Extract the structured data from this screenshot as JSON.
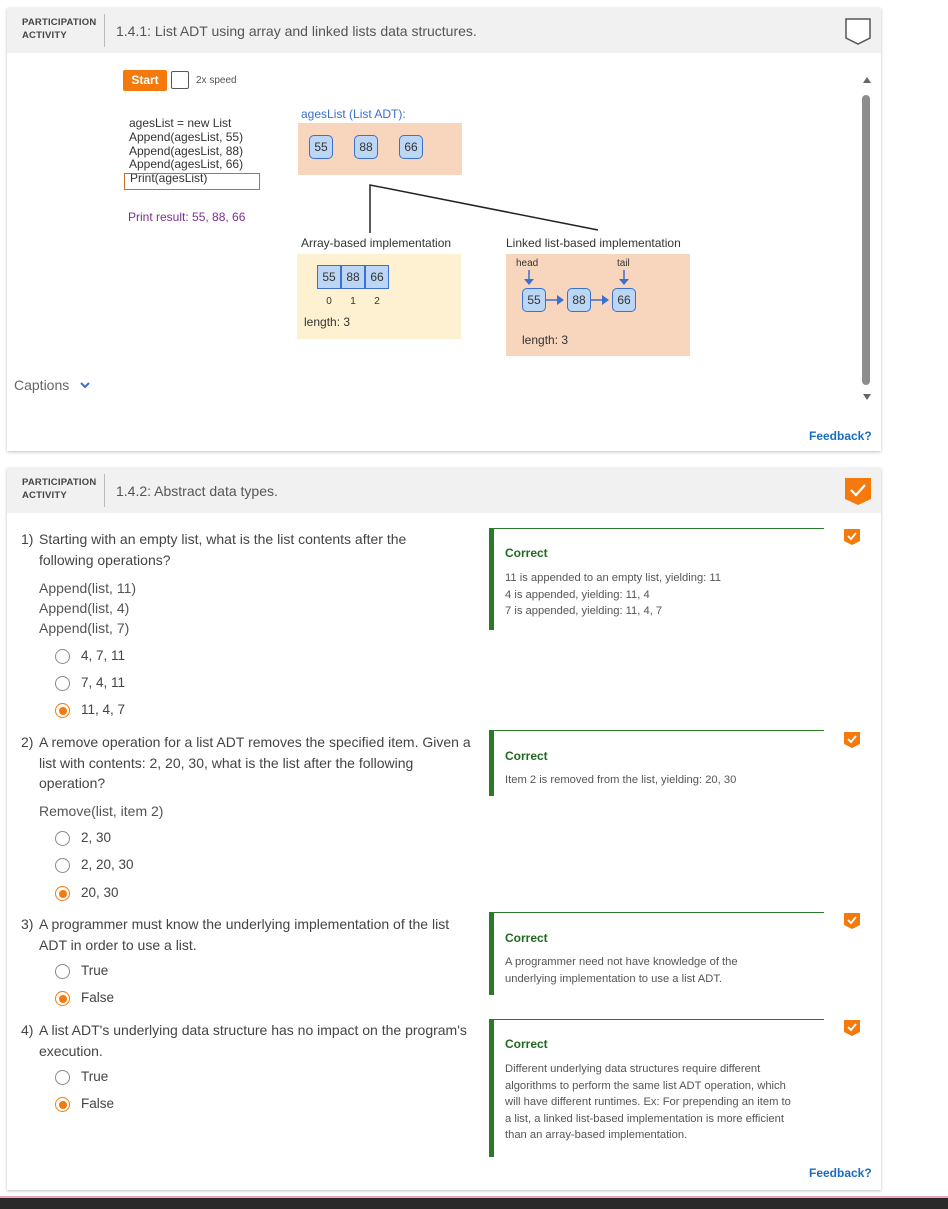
{
  "colors": {
    "accent": "#f47a0e",
    "correct": "#2a7a2a",
    "node_fill": "#bcd7f5",
    "node_border": "#3b6fd0"
  },
  "activity1": {
    "label_line1": "PARTICIPATION",
    "label_line2": "ACTIVITY",
    "title": "1.4.1: List ADT using array and linked lists data structures.",
    "start_label": "Start",
    "speed_label": "2x speed",
    "code_lines": [
      "agesList = new List",
      "Append(agesList, 55)",
      "Append(agesList, 88)",
      "Append(agesList, 66)",
      "Print(agesList)"
    ],
    "print_result": "Print result: 55, 88, 66",
    "adt_label": "agesList (List ADT):",
    "adt_values": [
      "55",
      "88",
      "66"
    ],
    "array_title": "Array-based implementation",
    "array_values": [
      "55",
      "88",
      "66"
    ],
    "array_indices": [
      "0",
      "1",
      "2"
    ],
    "array_length": "length: 3",
    "linked_title": "Linked list-based implementation",
    "head_label": "head",
    "tail_label": "tail",
    "linked_values": [
      "55",
      "88",
      "66"
    ],
    "linked_length": "length: 3",
    "captions_label": "Captions",
    "feedback_label": "Feedback?"
  },
  "activity2": {
    "label_line1": "PARTICIPATION",
    "label_line2": "ACTIVITY",
    "title": "1.4.2: Abstract data types.",
    "feedback_label": "Feedback?",
    "questions": [
      {
        "number": "1)",
        "text_lines": [
          "Starting with an empty list, what is the list contents after the",
          "following operations?"
        ],
        "code_lines": [
          "Append(list, 11)",
          "Append(list, 4)",
          "Append(list, 7)"
        ],
        "options": [
          "4, 7, 11",
          "7, 4, 11",
          "11, 4, 7"
        ],
        "selected": 2,
        "result": "Correct",
        "explanation": [
          "11 is appended to an empty list, yielding: 11",
          "4 is appended, yielding: 11, 4",
          "7 is appended, yielding: 11, 4, 7"
        ]
      },
      {
        "number": "2)",
        "text_lines": [
          "A remove operation for a list ADT removes the specified item. Given a",
          "list with contents: 2, 20, 30, what is the list after the following",
          "operation?"
        ],
        "code_lines": [
          "Remove(list, item 2)"
        ],
        "options": [
          "2, 30",
          "2, 20, 30",
          "20, 30"
        ],
        "selected": 2,
        "result": "Correct",
        "explanation": [
          "Item 2 is removed from the list, yielding: 20, 30"
        ]
      },
      {
        "number": "3)",
        "text_lines": [
          "A programmer must know the underlying implementation of the list",
          "ADT in order to use a list."
        ],
        "code_lines": [],
        "options": [
          "True",
          "False"
        ],
        "selected": 1,
        "result": "Correct",
        "explanation": [
          "A programmer need not have knowledge of the",
          "underlying implementation to use a list ADT."
        ]
      },
      {
        "number": "4)",
        "text_lines": [
          "A list ADT's underlying data structure has no impact on the program's",
          "execution."
        ],
        "code_lines": [],
        "options": [
          "True",
          "False"
        ],
        "selected": 1,
        "result": "Correct",
        "explanation": [
          "Different underlying data structures require different",
          "algorithms to perform the same list ADT operation, which",
          "will have different runtimes. Ex: For prepending an item to",
          "a list, a linked list-based implementation is more efficient",
          "than an array-based implementation."
        ]
      }
    ]
  }
}
